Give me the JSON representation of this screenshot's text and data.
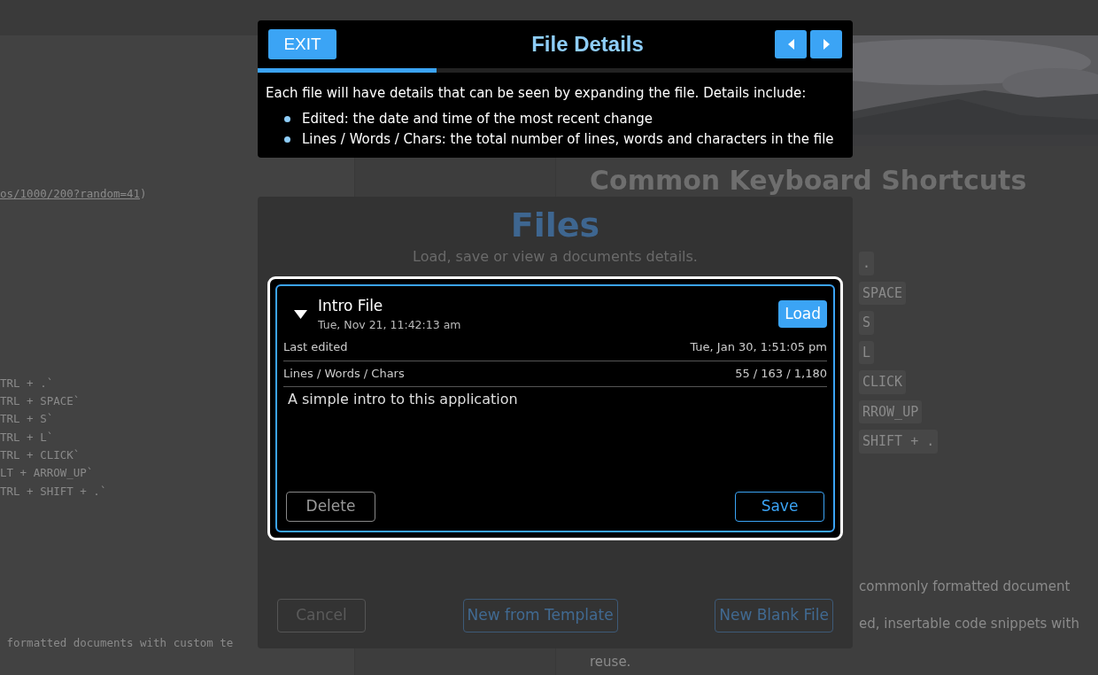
{
  "editor": {
    "link_text": "os/1000/200?random=41",
    "link_tail": ")",
    "shortcut_lines": [
      "TRL + .`",
      "TRL + SPACE`",
      "TRL + S`",
      "TRL + L`",
      "TRL + CLICK`",
      "LT + ARROW_UP`",
      "TRL + SHIFT + .`"
    ],
    "bottom_line": " formatted documents with custom te"
  },
  "preview": {
    "heading": "Common Keyboard Shortcuts",
    "shortcut_keys": [
      ".",
      "SPACE",
      "S",
      "L",
      "CLICK",
      "RROW_UP",
      "SHIFT + ."
    ],
    "text_lines": [
      {
        "text": "commonly formatted document",
        "kind": "inset"
      },
      {
        "text": "ed, insertable code snippets with",
        "kind": "inset"
      },
      {
        "text": "reuse.",
        "kind": "full"
      }
    ]
  },
  "files_dialog": {
    "title": "Files",
    "subtitle": "Load, save or view a documents details.",
    "files": [
      {
        "name": "Intro File",
        "created": "Tue, Nov 21, 11:42:13 am",
        "expanded": true,
        "highlighted": true,
        "load_label": "Load",
        "details": [
          {
            "label": "Last edited",
            "value": "Tue, Jan 30, 1:51:05 pm"
          },
          {
            "label": "Lines / Words / Chars",
            "value": "55 / 163 / 1,180"
          }
        ],
        "description": "A simple intro to this application",
        "delete_label": "Delete",
        "save_label": "Save"
      }
    ],
    "buttons": [
      {
        "label": "Cancel",
        "kind": "secondary"
      },
      {
        "label": "New from Template",
        "kind": "primary"
      },
      {
        "label": "New Blank File",
        "kind": "primary"
      }
    ]
  },
  "tour": {
    "exit_label": "EXIT",
    "title": "File Details",
    "progress": {
      "level": 0.3
    },
    "intro": "Each file will have details that can be seen by expanding the file. Details include:",
    "bullets": [
      "Edited: the date and time of the most recent change",
      "Lines / Words / Chars: the total number of lines, words and characters in the file"
    ]
  }
}
